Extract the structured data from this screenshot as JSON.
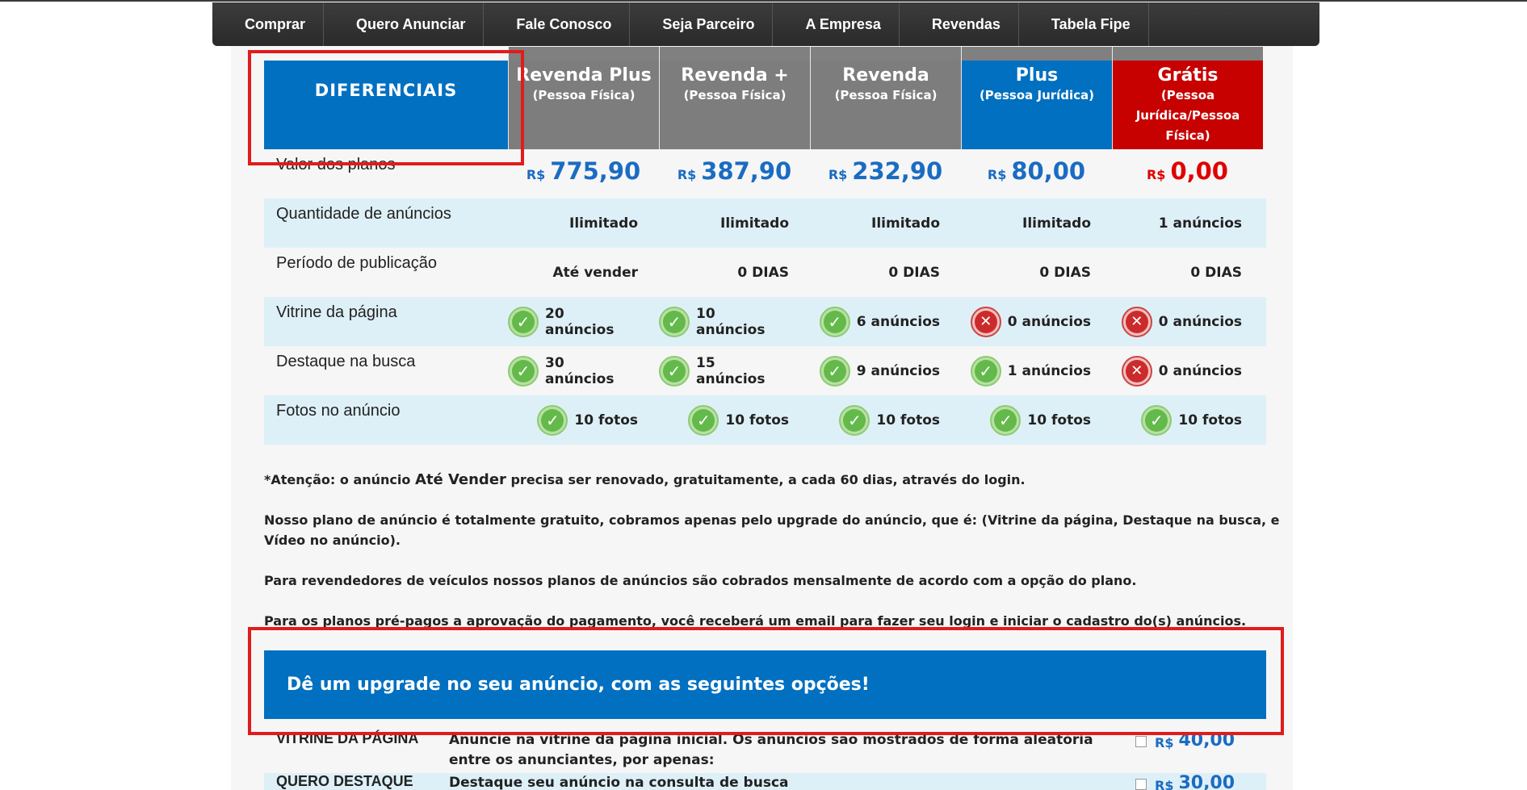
{
  "nav": [
    "Comprar",
    "Quero Anunciar",
    "Fale Conosco",
    "Seja Parceiro",
    "A Empresa",
    "Revendas",
    "Tabela Fipe"
  ],
  "header": {
    "first": "DIFERENCIAIS",
    "plans": [
      {
        "name": "Revenda Plus",
        "sub": "(Pessoa Física)",
        "style": "gray"
      },
      {
        "name": "Revenda +",
        "sub": "(Pessoa Física)",
        "style": "gray"
      },
      {
        "name": "Revenda",
        "sub": "(Pessoa Física)",
        "style": "gray"
      },
      {
        "name": "Plus",
        "sub": "(Pessoa Jurídica)",
        "style": "blue"
      },
      {
        "name": "Grátis",
        "sub": "(Pessoa Jurídica/Pessoa Física)",
        "style": "red"
      }
    ]
  },
  "currency": "R$",
  "rows": {
    "price": {
      "label": "Valor dos planos",
      "values": [
        "775,90",
        "387,90",
        "232,90",
        "80,00",
        "0,00"
      ]
    },
    "qty": {
      "label": "Quantidade de anúncios",
      "values": [
        "Ilimitado",
        "Ilimitado",
        "Ilimitado",
        "Ilimitado",
        "1 anúncios"
      ]
    },
    "period": {
      "label": "Período de publicação",
      "values": [
        "Até vender",
        "0 DIAS",
        "0 DIAS",
        "0 DIAS",
        "0 DIAS"
      ]
    },
    "vitrine": {
      "label": "Vitrine da página",
      "values": [
        "20 anúncios",
        "10 anúncios",
        "6 anúncios",
        "0 anúncios",
        "0 anúncios"
      ],
      "ok": [
        true,
        true,
        true,
        false,
        false
      ]
    },
    "destaque": {
      "label": "Destaque na busca",
      "values": [
        "30 anúncios",
        "15 anúncios",
        "9 anúncios",
        "1 anúncios",
        "0 anúncios"
      ],
      "ok": [
        true,
        true,
        true,
        true,
        false
      ]
    },
    "fotos": {
      "label": "Fotos no anúncio",
      "values": [
        "10 fotos",
        "10 fotos",
        "10 fotos",
        "10 fotos",
        "10 fotos"
      ],
      "ok": [
        true,
        true,
        true,
        true,
        true
      ]
    }
  },
  "notes": {
    "n1_pre": "*Atenção: o anúncio ",
    "n1_em": "Até Vender",
    "n1_post": " precisa ser renovado, gratuitamente, a cada 60 dias, através do login.",
    "n2": "Nosso plano de anúncio é totalmente gratuito, cobramos apenas pelo upgrade do anúncio, que é: (Vitrine da página, Destaque na busca, e Vídeo no anúncio).",
    "n3": "Para revendedores de veículos nossos planos de anúncios são cobrados mensalmente de acordo com a opção do plano.",
    "n4": "Para os planos pré-pagos a aprovação do pagamento, você receberá um email para fazer seu login e iniciar o cadastro do(s) anúncios."
  },
  "upgrade": {
    "banner": "Dê um upgrade no seu anúncio, com as seguintes opções!",
    "items": [
      {
        "label": "VITRINE DA PÁGINA",
        "desc": "Anuncie na vitrine da página inicial. Os anúncios são mostrados de forma aleatória entre os anunciantes, por apenas:",
        "price": "40,00"
      },
      {
        "label": "QUERO DESTAQUE",
        "desc": "Destaque seu anúncio na consulta de busca",
        "price": "30,00"
      }
    ]
  }
}
